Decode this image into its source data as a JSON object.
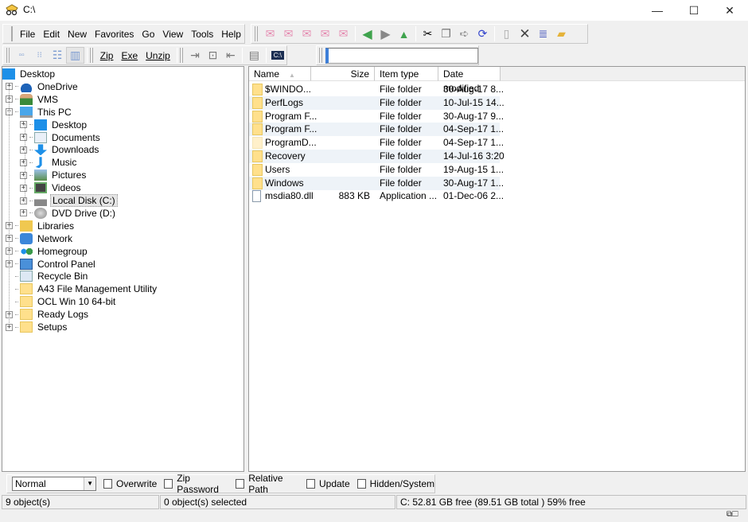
{
  "window": {
    "title": "C:\\",
    "minimize": "—",
    "maximize": "☐",
    "close": "✕"
  },
  "menu": [
    "File",
    "Edit",
    "New",
    "Favorites",
    "Go",
    "View",
    "Tools",
    "Help"
  ],
  "toolbar1_icons": [
    "favorite-1-icon",
    "favorite-2-icon",
    "favorite-3-icon",
    "favorite-4-icon",
    "favorite-5-icon",
    "back-icon",
    "forward-icon",
    "up-icon",
    "cut-icon",
    "copy-icon",
    "move-to-icon",
    "refresh-icon",
    "paste-icon",
    "delete-icon",
    "properties-icon",
    "new-folder-icon"
  ],
  "toolbar2": {
    "zip": "Zip",
    "exe": "Exe",
    "unzip": "Unzip",
    "cmd": "C:\\"
  },
  "address": {
    "value": ""
  },
  "tree": [
    {
      "label": "Desktop",
      "level": 0,
      "exp": "",
      "icon": "desktop"
    },
    {
      "label": "OneDrive",
      "level": 1,
      "exp": "+",
      "icon": "cloud"
    },
    {
      "label": "VMS",
      "level": 1,
      "exp": "+",
      "icon": "user"
    },
    {
      "label": "This PC",
      "level": 1,
      "exp": "−",
      "icon": "pc"
    },
    {
      "label": "Desktop",
      "level": 2,
      "exp": "+",
      "icon": "desktop"
    },
    {
      "label": "Documents",
      "level": 2,
      "exp": "+",
      "icon": "doc"
    },
    {
      "label": "Downloads",
      "level": 2,
      "exp": "+",
      "icon": "download"
    },
    {
      "label": "Music",
      "level": 2,
      "exp": "+",
      "icon": "music"
    },
    {
      "label": "Pictures",
      "level": 2,
      "exp": "+",
      "icon": "picture"
    },
    {
      "label": "Videos",
      "level": 2,
      "exp": "+",
      "icon": "video"
    },
    {
      "label": "Local Disk (C:)",
      "level": 2,
      "exp": "+",
      "icon": "disk",
      "selected": true
    },
    {
      "label": "DVD Drive (D:)",
      "level": 2,
      "exp": "+",
      "icon": "dvd"
    },
    {
      "label": "Libraries",
      "level": 1,
      "exp": "+",
      "icon": "library"
    },
    {
      "label": "Network",
      "level": 1,
      "exp": "+",
      "icon": "network"
    },
    {
      "label": "Homegroup",
      "level": 1,
      "exp": "+",
      "icon": "homegroup"
    },
    {
      "label": "Control Panel",
      "level": 1,
      "exp": "+",
      "icon": "control"
    },
    {
      "label": "Recycle Bin",
      "level": 1,
      "exp": "",
      "icon": "recycle"
    },
    {
      "label": "A43 File Management Utility",
      "level": 1,
      "exp": "",
      "icon": "folder"
    },
    {
      "label": "OCL Win 10 64-bit",
      "level": 1,
      "exp": "",
      "icon": "folder"
    },
    {
      "label": "Ready Logs",
      "level": 1,
      "exp": "+",
      "icon": "folder"
    },
    {
      "label": "Setups",
      "level": 1,
      "exp": "+",
      "icon": "folder"
    }
  ],
  "list": {
    "columns": [
      "Name",
      "Size",
      "Item type",
      "Date modified"
    ],
    "rows": [
      {
        "name": "$WINDO...",
        "size": "",
        "type": "File folder",
        "date": "30-Aug-17 8...",
        "icon": "folder"
      },
      {
        "name": "PerfLogs",
        "size": "",
        "type": "File folder",
        "date": "10-Jul-15 14...",
        "icon": "folder"
      },
      {
        "name": "Program F...",
        "size": "",
        "type": "File folder",
        "date": "30-Aug-17 9...",
        "icon": "folder"
      },
      {
        "name": "Program F...",
        "size": "",
        "type": "File folder",
        "date": "04-Sep-17 1...",
        "icon": "folder"
      },
      {
        "name": "ProgramD...",
        "size": "",
        "type": "File folder",
        "date": "04-Sep-17 1...",
        "icon": "folder-hidden"
      },
      {
        "name": "Recovery",
        "size": "",
        "type": "File folder",
        "date": "14-Jul-16 3:20",
        "icon": "folder"
      },
      {
        "name": "Users",
        "size": "",
        "type": "File folder",
        "date": "19-Aug-15 1...",
        "icon": "folder"
      },
      {
        "name": "Windows",
        "size": "",
        "type": "File folder",
        "date": "30-Aug-17 1...",
        "icon": "folder"
      },
      {
        "name": "msdia80.dll",
        "size": "883 KB",
        "type": "Application ...",
        "date": "01-Dec-06 2...",
        "icon": "dll"
      }
    ]
  },
  "options": {
    "mode": "Normal",
    "checks": [
      {
        "label": "Overwrite",
        "checked": false
      },
      {
        "label": "Zip Password",
        "checked": false
      },
      {
        "label": "Relative Path",
        "checked": false
      },
      {
        "label": "Update",
        "checked": false
      },
      {
        "label": "Hidden/System",
        "checked": false
      }
    ]
  },
  "status": {
    "objects": "9 object(s)",
    "selected": "0 object(s) selected",
    "disk": "C: 52.81 GB free (89.51 GB total )  59% free"
  }
}
